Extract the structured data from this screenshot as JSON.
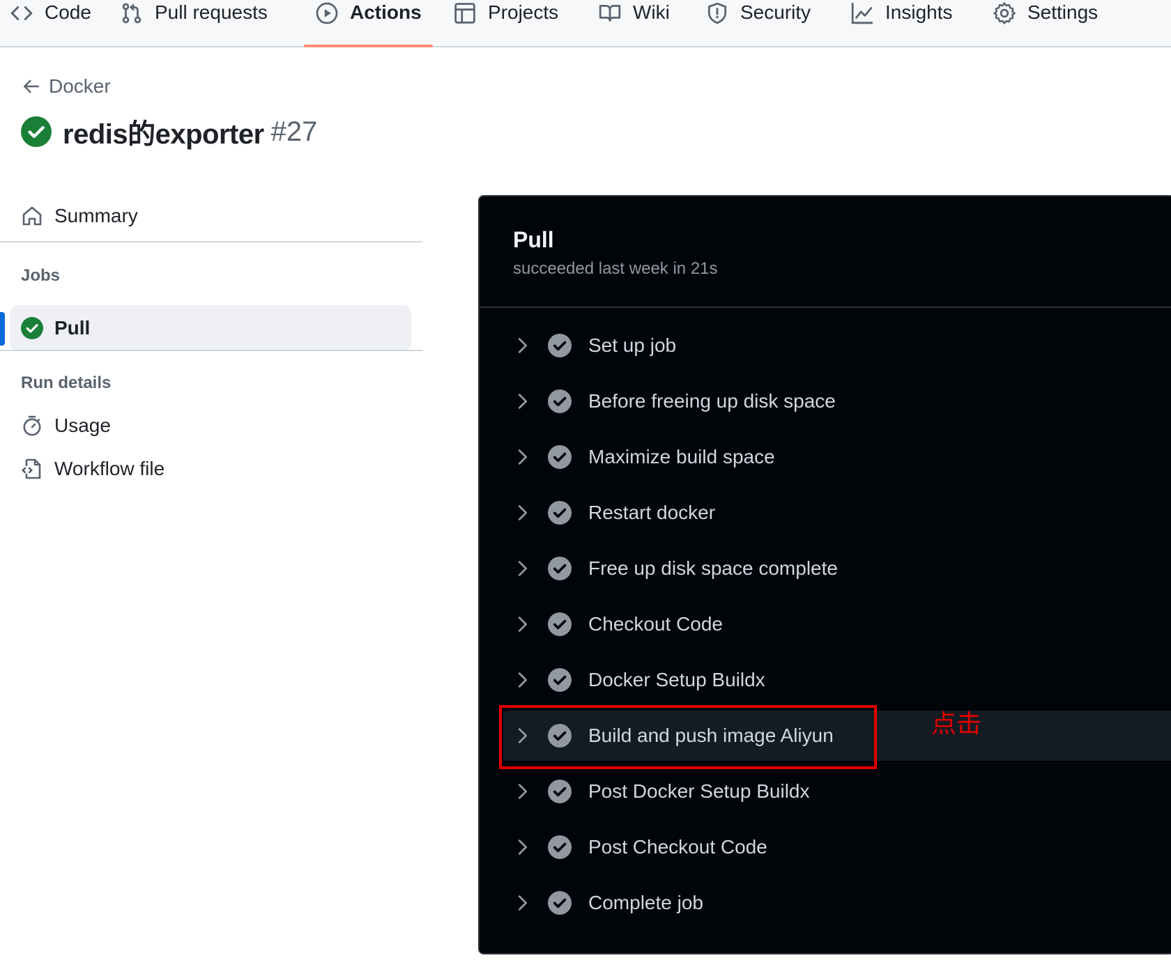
{
  "nav": {
    "tabs": [
      {
        "label": "Code",
        "icon": "code-icon"
      },
      {
        "label": "Pull requests",
        "icon": "pull-request-icon"
      },
      {
        "label": "Actions",
        "icon": "play-icon",
        "active": true
      },
      {
        "label": "Projects",
        "icon": "table-icon"
      },
      {
        "label": "Wiki",
        "icon": "book-icon"
      },
      {
        "label": "Security",
        "icon": "shield-icon"
      },
      {
        "label": "Insights",
        "icon": "graph-icon"
      },
      {
        "label": "Settings",
        "icon": "gear-icon"
      }
    ]
  },
  "header": {
    "back_label": "Docker",
    "run_name": "redis的exporter",
    "run_number": "#27"
  },
  "sidebar": {
    "summary_label": "Summary",
    "jobs_heading": "Jobs",
    "job_label": "Pull",
    "run_details_heading": "Run details",
    "usage_label": "Usage",
    "workflow_label": "Workflow file"
  },
  "panel": {
    "title": "Pull",
    "subtitle": "succeeded last week in 21s",
    "steps": [
      "Set up job",
      "Before freeing up disk space",
      "Maximize build space",
      "Restart docker",
      "Free up disk space complete",
      "Checkout Code",
      "Docker Setup Buildx",
      "Build and push image Aliyun",
      "Post Docker Setup Buildx",
      "Post Checkout Code",
      "Complete job"
    ]
  },
  "annotation": {
    "text": "点击"
  },
  "colors": {
    "success": "#1a7f37",
    "active_tab_underline": "#fd8c73",
    "annotation_red": "#e00000",
    "panel_bg": "#010409"
  }
}
